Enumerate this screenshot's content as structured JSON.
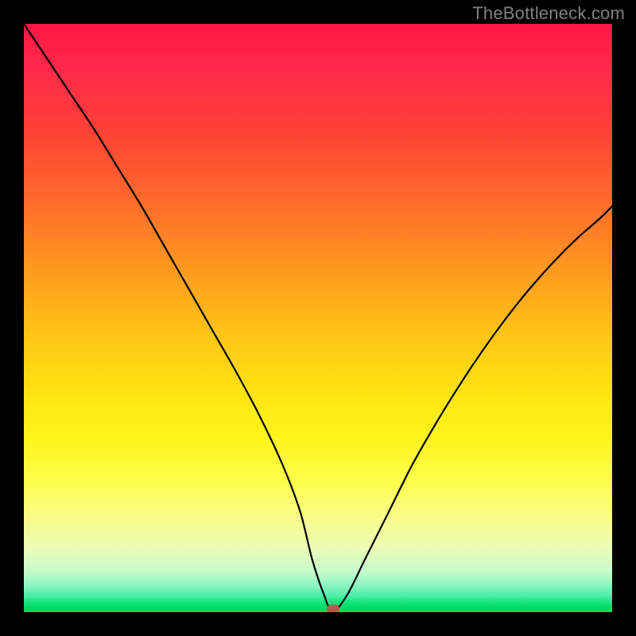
{
  "watermark": "TheBottleneck.com",
  "chart_data": {
    "type": "line",
    "title": "",
    "xlabel": "",
    "ylabel": "",
    "xlim": [
      0,
      100
    ],
    "ylim": [
      0,
      100
    ],
    "grid": false,
    "legend": false,
    "series": [
      {
        "name": "bottleneck-curve",
        "x": [
          0,
          4,
          8,
          12,
          16,
          20,
          24,
          28,
          32,
          36,
          40,
          44,
          47,
          49,
          51,
          52.5,
          55,
          58,
          62,
          66,
          70,
          74,
          78,
          82,
          86,
          90,
          94,
          98,
          100
        ],
        "values": [
          100,
          94,
          88,
          82,
          75.5,
          69,
          62,
          55,
          48,
          41,
          33.5,
          25,
          17,
          9,
          3,
          0,
          3,
          9,
          17,
          25,
          32,
          38.5,
          44.5,
          50,
          55,
          59.5,
          63.5,
          67,
          69
        ]
      }
    ],
    "marker": {
      "x": 52.5,
      "y": 0,
      "name": "optimal-point"
    },
    "colors": {
      "curve": "#000000",
      "marker": "#b85a4a",
      "gradient_top": "#ff1744",
      "gradient_mid": "#ffe213",
      "gradient_bottom": "#00d94f"
    }
  }
}
